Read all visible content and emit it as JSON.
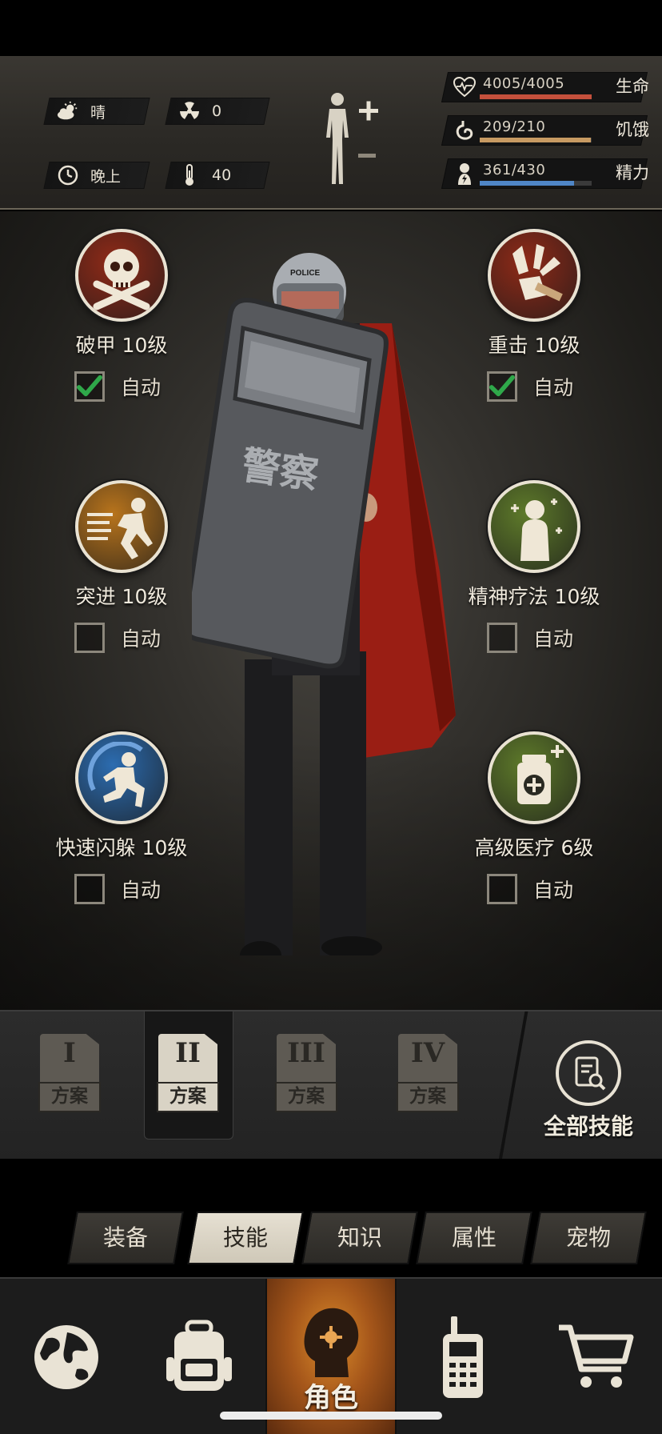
{
  "environment": {
    "weather": {
      "icon": "sun-cloud-icon",
      "text": "晴"
    },
    "radiation": {
      "icon": "radiation-icon",
      "text": "0"
    },
    "time": {
      "icon": "clock-icon",
      "text": "晚上"
    },
    "temperature": {
      "icon": "thermometer-icon",
      "text": "40"
    }
  },
  "vitals": [
    {
      "icon": "heart-icon",
      "value": "4005/4005",
      "label": "生命",
      "fraction": 1.0,
      "color": "#c4503c"
    },
    {
      "icon": "stomach-icon",
      "value": "209/210",
      "label": "饥饿",
      "fraction": 0.995,
      "color": "#c79a62"
    },
    {
      "icon": "energy-icon",
      "value": "361/430",
      "label": "精力",
      "fraction": 0.84,
      "color": "#4f86c6"
    }
  ],
  "skills": [
    {
      "name": "破甲 10级",
      "icon": "skull-crossbones-icon",
      "auto_label": "自动",
      "auto": true,
      "bg": "#8f2a18"
    },
    {
      "name": "重击 10级",
      "icon": "axe-strike-icon",
      "auto_label": "自动",
      "auto": true,
      "bg": "#8f2a18"
    },
    {
      "name": "突进 10级",
      "icon": "dash-runner-icon",
      "auto_label": "自动",
      "auto": false,
      "bg": "#b8741c"
    },
    {
      "name": "精神疗法 10级",
      "icon": "mind-heal-icon",
      "auto_label": "自动",
      "auto": false,
      "bg": "#5e7a2a"
    },
    {
      "name": "快速闪躲 10级",
      "icon": "dodge-icon",
      "auto_label": "自动",
      "auto": false,
      "bg": "#2c6cb0"
    },
    {
      "name": "高级医疗 6级",
      "icon": "medkit-icon",
      "auto_label": "自动",
      "auto": false,
      "bg": "#5e7a2a"
    }
  ],
  "plans": [
    {
      "numeral": "I",
      "label": "方案",
      "active": false
    },
    {
      "numeral": "II",
      "label": "方案",
      "active": true
    },
    {
      "numeral": "III",
      "label": "方案",
      "active": false
    },
    {
      "numeral": "IV",
      "label": "方案",
      "active": false
    }
  ],
  "all_skills": {
    "label": "全部技能",
    "icon": "search-document-icon"
  },
  "tabs": [
    {
      "label": "装备",
      "active": false
    },
    {
      "label": "技能",
      "active": true
    },
    {
      "label": "知识",
      "active": false
    },
    {
      "label": "属性",
      "active": false
    },
    {
      "label": "宠物",
      "active": false
    }
  ],
  "bottom_nav": [
    {
      "icon": "globe-icon",
      "label": "",
      "active": false
    },
    {
      "icon": "backpack-icon",
      "label": "",
      "active": false
    },
    {
      "icon": "character-head-icon",
      "label": "角色",
      "active": true
    },
    {
      "icon": "walkie-talkie-icon",
      "label": "",
      "active": false
    },
    {
      "icon": "shopping-cart-icon",
      "label": "",
      "active": false
    }
  ],
  "character": {
    "shield_text": "警察",
    "helmet_text": "POLICE"
  }
}
